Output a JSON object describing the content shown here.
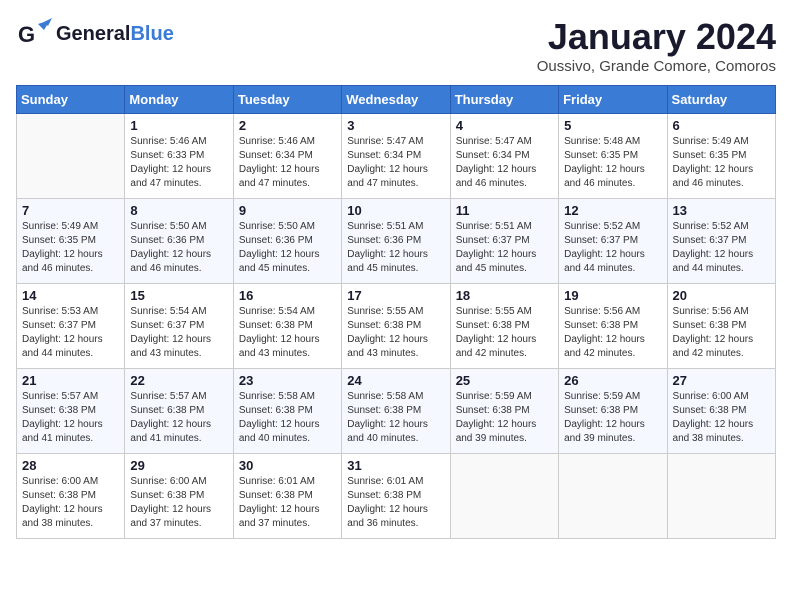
{
  "header": {
    "logo_line1": "General",
    "logo_line2": "Blue",
    "title": "January 2024",
    "subtitle": "Oussivo, Grande Comore, Comoros"
  },
  "days_of_week": [
    "Sunday",
    "Monday",
    "Tuesday",
    "Wednesday",
    "Thursday",
    "Friday",
    "Saturday"
  ],
  "weeks": [
    [
      {
        "num": "",
        "info": ""
      },
      {
        "num": "1",
        "info": "Sunrise: 5:46 AM\nSunset: 6:33 PM\nDaylight: 12 hours\nand 47 minutes."
      },
      {
        "num": "2",
        "info": "Sunrise: 5:46 AM\nSunset: 6:34 PM\nDaylight: 12 hours\nand 47 minutes."
      },
      {
        "num": "3",
        "info": "Sunrise: 5:47 AM\nSunset: 6:34 PM\nDaylight: 12 hours\nand 47 minutes."
      },
      {
        "num": "4",
        "info": "Sunrise: 5:47 AM\nSunset: 6:34 PM\nDaylight: 12 hours\nand 46 minutes."
      },
      {
        "num": "5",
        "info": "Sunrise: 5:48 AM\nSunset: 6:35 PM\nDaylight: 12 hours\nand 46 minutes."
      },
      {
        "num": "6",
        "info": "Sunrise: 5:49 AM\nSunset: 6:35 PM\nDaylight: 12 hours\nand 46 minutes."
      }
    ],
    [
      {
        "num": "7",
        "info": "Sunrise: 5:49 AM\nSunset: 6:35 PM\nDaylight: 12 hours\nand 46 minutes."
      },
      {
        "num": "8",
        "info": "Sunrise: 5:50 AM\nSunset: 6:36 PM\nDaylight: 12 hours\nand 46 minutes."
      },
      {
        "num": "9",
        "info": "Sunrise: 5:50 AM\nSunset: 6:36 PM\nDaylight: 12 hours\nand 45 minutes."
      },
      {
        "num": "10",
        "info": "Sunrise: 5:51 AM\nSunset: 6:36 PM\nDaylight: 12 hours\nand 45 minutes."
      },
      {
        "num": "11",
        "info": "Sunrise: 5:51 AM\nSunset: 6:37 PM\nDaylight: 12 hours\nand 45 minutes."
      },
      {
        "num": "12",
        "info": "Sunrise: 5:52 AM\nSunset: 6:37 PM\nDaylight: 12 hours\nand 44 minutes."
      },
      {
        "num": "13",
        "info": "Sunrise: 5:52 AM\nSunset: 6:37 PM\nDaylight: 12 hours\nand 44 minutes."
      }
    ],
    [
      {
        "num": "14",
        "info": "Sunrise: 5:53 AM\nSunset: 6:37 PM\nDaylight: 12 hours\nand 44 minutes."
      },
      {
        "num": "15",
        "info": "Sunrise: 5:54 AM\nSunset: 6:37 PM\nDaylight: 12 hours\nand 43 minutes."
      },
      {
        "num": "16",
        "info": "Sunrise: 5:54 AM\nSunset: 6:38 PM\nDaylight: 12 hours\nand 43 minutes."
      },
      {
        "num": "17",
        "info": "Sunrise: 5:55 AM\nSunset: 6:38 PM\nDaylight: 12 hours\nand 43 minutes."
      },
      {
        "num": "18",
        "info": "Sunrise: 5:55 AM\nSunset: 6:38 PM\nDaylight: 12 hours\nand 42 minutes."
      },
      {
        "num": "19",
        "info": "Sunrise: 5:56 AM\nSunset: 6:38 PM\nDaylight: 12 hours\nand 42 minutes."
      },
      {
        "num": "20",
        "info": "Sunrise: 5:56 AM\nSunset: 6:38 PM\nDaylight: 12 hours\nand 42 minutes."
      }
    ],
    [
      {
        "num": "21",
        "info": "Sunrise: 5:57 AM\nSunset: 6:38 PM\nDaylight: 12 hours\nand 41 minutes."
      },
      {
        "num": "22",
        "info": "Sunrise: 5:57 AM\nSunset: 6:38 PM\nDaylight: 12 hours\nand 41 minutes."
      },
      {
        "num": "23",
        "info": "Sunrise: 5:58 AM\nSunset: 6:38 PM\nDaylight: 12 hours\nand 40 minutes."
      },
      {
        "num": "24",
        "info": "Sunrise: 5:58 AM\nSunset: 6:38 PM\nDaylight: 12 hours\nand 40 minutes."
      },
      {
        "num": "25",
        "info": "Sunrise: 5:59 AM\nSunset: 6:38 PM\nDaylight: 12 hours\nand 39 minutes."
      },
      {
        "num": "26",
        "info": "Sunrise: 5:59 AM\nSunset: 6:38 PM\nDaylight: 12 hours\nand 39 minutes."
      },
      {
        "num": "27",
        "info": "Sunrise: 6:00 AM\nSunset: 6:38 PM\nDaylight: 12 hours\nand 38 minutes."
      }
    ],
    [
      {
        "num": "28",
        "info": "Sunrise: 6:00 AM\nSunset: 6:38 PM\nDaylight: 12 hours\nand 38 minutes."
      },
      {
        "num": "29",
        "info": "Sunrise: 6:00 AM\nSunset: 6:38 PM\nDaylight: 12 hours\nand 37 minutes."
      },
      {
        "num": "30",
        "info": "Sunrise: 6:01 AM\nSunset: 6:38 PM\nDaylight: 12 hours\nand 37 minutes."
      },
      {
        "num": "31",
        "info": "Sunrise: 6:01 AM\nSunset: 6:38 PM\nDaylight: 12 hours\nand 36 minutes."
      },
      {
        "num": "",
        "info": ""
      },
      {
        "num": "",
        "info": ""
      },
      {
        "num": "",
        "info": ""
      }
    ]
  ]
}
